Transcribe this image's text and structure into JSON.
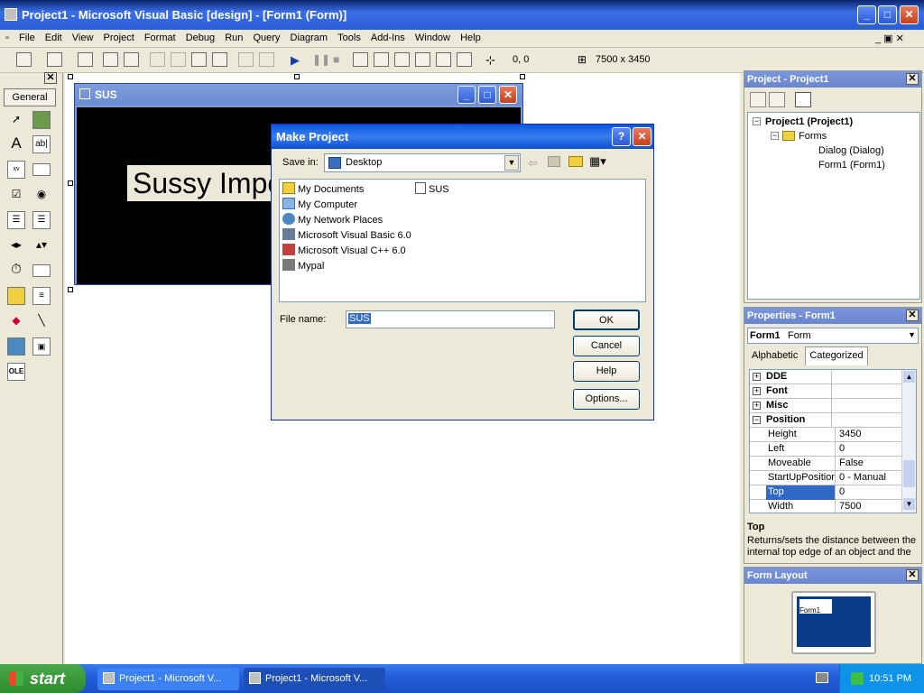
{
  "window": {
    "title": "Project1 - Microsoft Visual Basic [design] - [Form1 (Form)]"
  },
  "menu": [
    "File",
    "Edit",
    "View",
    "Project",
    "Format",
    "Debug",
    "Run",
    "Query",
    "Diagram",
    "Tools",
    "Add-Ins",
    "Window",
    "Help"
  ],
  "toolbar": {
    "position": "0, 0",
    "size": "7500 x 3450"
  },
  "toolbox": {
    "tab_label": "General"
  },
  "form": {
    "title": "SUS",
    "label_text": "Sussy Impo"
  },
  "dialog": {
    "title": "Make Project",
    "save_in_label": "Save in:",
    "save_in_value": "Desktop",
    "items": [
      "My Documents",
      "My Computer",
      "My Network Places",
      "Microsoft Visual Basic 6.0",
      "Microsoft Visual C++ 6.0",
      "Mypal"
    ],
    "items_col2": [
      "SUS"
    ],
    "file_name_label": "File name:",
    "file_name_value": "SUS",
    "buttons": {
      "ok": "OK",
      "cancel": "Cancel",
      "help": "Help",
      "options": "Options..."
    }
  },
  "project_panel": {
    "title": "Project - Project1",
    "tree": {
      "root": "Project1 (Project1)",
      "folder": "Forms",
      "children": [
        "Dialog (Dialog)",
        "Form1 (Form1)"
      ]
    }
  },
  "properties_panel": {
    "title": "Properties - Form1",
    "object_name": "Form1",
    "object_type": "Form",
    "tabs": {
      "alphabetic": "Alphabetic",
      "categorized": "Categorized"
    },
    "categories": [
      "DDE",
      "Font",
      "Misc",
      "Position"
    ],
    "rows": [
      {
        "key": "Height",
        "value": "3450"
      },
      {
        "key": "Left",
        "value": "0"
      },
      {
        "key": "Moveable",
        "value": "False"
      },
      {
        "key": "StartUpPosition",
        "value": "0 - Manual"
      },
      {
        "key": "Top",
        "value": "0"
      },
      {
        "key": "Width",
        "value": "7500"
      }
    ],
    "description_title": "Top",
    "description_text": "Returns/sets the distance between the internal top edge of an object and the"
  },
  "form_layout_panel": {
    "title": "Form Layout",
    "preview_label": "Form1"
  },
  "taskbar": {
    "start_label": "start",
    "tasks": [
      "Project1 - Microsoft V...",
      "Project1 - Microsoft V..."
    ],
    "clock": "10:51 PM"
  },
  "colors": {
    "title_blue": "#0a58e0",
    "taskbar_blue": "#245edb",
    "start_green": "#2d8c2d",
    "selected": "#316ac5"
  }
}
